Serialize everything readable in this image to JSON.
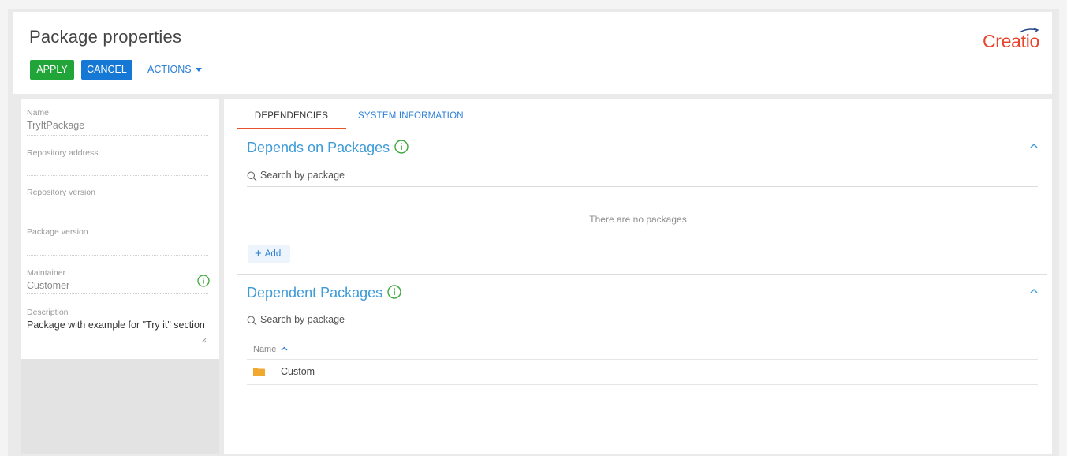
{
  "header": {
    "title": "Package properties",
    "apply_label": "APPLY",
    "cancel_label": "CANCEL",
    "actions_label": "ACTIONS",
    "logo_text": "Creatio"
  },
  "properties": {
    "name": {
      "label": "Name",
      "value": "TryItPackage"
    },
    "repository_address": {
      "label": "Repository address",
      "value": ""
    },
    "repository_version": {
      "label": "Repository version",
      "value": ""
    },
    "package_version": {
      "label": "Package version",
      "value": ""
    },
    "maintainer": {
      "label": "Maintainer",
      "value": "Customer"
    },
    "description": {
      "label": "Description",
      "value": "Package with example for \"Try it\" section"
    }
  },
  "tabs": [
    {
      "label": "DEPENDENCIES",
      "active": true
    },
    {
      "label": "SYSTEM INFORMATION",
      "active": false
    }
  ],
  "depends_on": {
    "title": "Depends on Packages",
    "search_placeholder": "Search by package",
    "empty_message": "There are no packages",
    "add_label": "Add"
  },
  "dependent": {
    "title": "Dependent Packages",
    "search_placeholder": "Search by package",
    "column_name": "Name",
    "rows": [
      {
        "name": "Custom",
        "icon": "folder-icon"
      }
    ]
  },
  "colors": {
    "apply": "#21a539",
    "cancel": "#1578d5",
    "accent": "#2b7fd6",
    "section_title": "#3d9bd8",
    "tab_active_underline": "#e8532c",
    "logo": "#e8442c",
    "info_icon": "#3aa63a",
    "folder": "#f0a92e"
  }
}
